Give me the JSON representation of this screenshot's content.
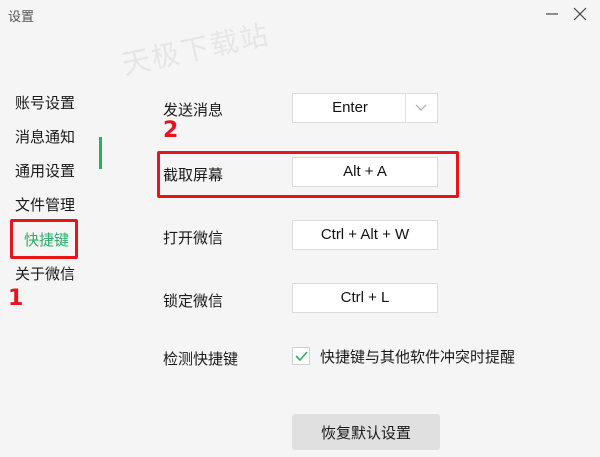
{
  "window": {
    "title": "设置",
    "minimize_icon": "minimize-icon",
    "close_icon": "close-icon"
  },
  "watermark": "天极下载站",
  "sidebar": {
    "items": [
      {
        "label": "账号设置"
      },
      {
        "label": "消息通知"
      },
      {
        "label": "通用设置"
      },
      {
        "label": "文件管理"
      },
      {
        "label": "快捷键",
        "active": true
      },
      {
        "label": "关于微信"
      }
    ],
    "active_color": "#2aae67"
  },
  "annotations": {
    "marker1": "1",
    "marker2": "2",
    "highlight_color": "#e8141c"
  },
  "shortcuts": {
    "send_message": {
      "label": "发送消息",
      "value": "Enter"
    },
    "screenshot": {
      "label": "截取屏幕",
      "value": "Alt + A"
    },
    "open_wechat": {
      "label": "打开微信",
      "value": "Ctrl + Alt + W"
    },
    "lock_wechat": {
      "label": "锁定微信",
      "value": "Ctrl + L"
    },
    "detect": {
      "label": "检测快捷键",
      "checkbox_label": "快捷键与其他软件冲突时提醒",
      "checked": true
    }
  },
  "restore_button": "恢复默认设置"
}
